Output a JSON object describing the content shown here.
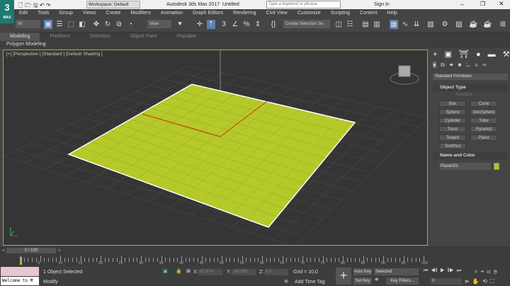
{
  "titlebar": {
    "logo": "3",
    "logo_sub": "MAX",
    "workspace": "Workspace: Default",
    "app_title": "Autodesk 3ds Max 2017",
    "doc_title": "Untitled",
    "search_placeholder": "Type a keyword or phrase",
    "sign_in": "Sign In"
  },
  "menu": [
    "Edit",
    "Tools",
    "Group",
    "Views",
    "Create",
    "Modifiers",
    "Animation",
    "Graph Editors",
    "Rendering",
    "Civil View",
    "Customize",
    "Scripting",
    "Content",
    "Help"
  ],
  "toolbar": {
    "filter": "All",
    "ref_coord": "View",
    "selection_set": "Create Selection Se"
  },
  "ribbon": {
    "tabs": [
      "Modeling",
      "Freeform",
      "Selection",
      "Object Paint",
      "Populate"
    ],
    "active": "Modeling",
    "sub": "Polygon Modeling"
  },
  "viewport": {
    "labels": "[+] [Perspective ] [Standard ] [Default Shading ]",
    "object_color": "#b5c92a"
  },
  "command_panel": {
    "category": "Standard Primitives",
    "object_type_title": "Object Type",
    "autogrid": "AutoGrid",
    "buttons": [
      "Box",
      "Cone",
      "Sphere",
      "GeoSphere",
      "Cylinder",
      "Tube",
      "Torus",
      "Pyramid",
      "Teapot",
      "Plane",
      "TextPlus"
    ],
    "name_color_title": "Name and Color",
    "object_name": "Plane001",
    "object_color": "#a8c81e"
  },
  "timeline": {
    "frame": "0 / 100",
    "ticks": [
      "5",
      "10",
      "15",
      "20",
      "25",
      "30",
      "35",
      "40",
      "45",
      "50",
      "55",
      "60",
      "65",
      "70",
      "75",
      "80",
      "85",
      "90",
      "95",
      "100"
    ]
  },
  "status": {
    "script_listener": "Welcome to M",
    "selected": "1 Object Selected",
    "prompt": "Modify",
    "x_label": "X:",
    "x": "87,374",
    "y_label": "Y:",
    "y": "-86,009",
    "z_label": "Z:",
    "z": "0,0",
    "grid": "Grid = 10,0",
    "add_time_tag": "Add Time Tag",
    "auto_key": "Auto Key",
    "set_key": "Set Key",
    "key_mode": "Selected",
    "key_filters": "Key Filters...",
    "current_frame": "0"
  }
}
